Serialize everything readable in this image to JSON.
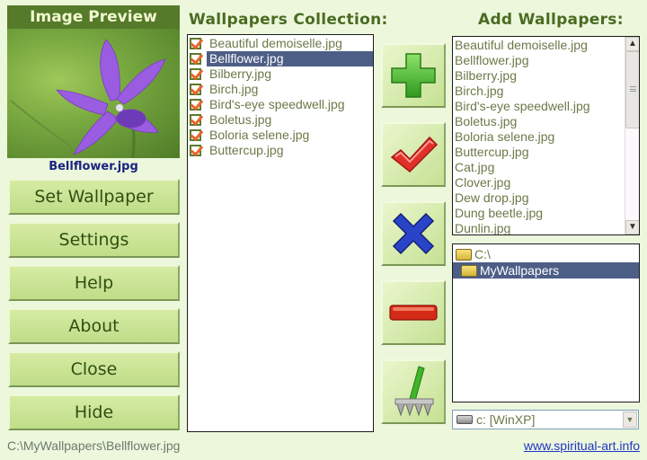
{
  "preview": {
    "title": "Image Preview",
    "caption": "Bellflower.jpg"
  },
  "left_buttons": [
    {
      "label": "Set Wallpaper"
    },
    {
      "label": "Settings"
    },
    {
      "label": "Help"
    },
    {
      "label": "About"
    },
    {
      "label": "Close"
    },
    {
      "label": "Hide"
    }
  ],
  "collection": {
    "title": "Wallpapers Collection:",
    "items": [
      {
        "label": "Beautiful demoiselle.jpg",
        "checked": true,
        "selected": false
      },
      {
        "label": "Bellflower.jpg",
        "checked": true,
        "selected": true
      },
      {
        "label": "Bilberry.jpg",
        "checked": true,
        "selected": false
      },
      {
        "label": "Birch.jpg",
        "checked": true,
        "selected": false
      },
      {
        "label": "Bird's-eye speedwell.jpg",
        "checked": true,
        "selected": false
      },
      {
        "label": "Boletus.jpg",
        "checked": true,
        "selected": false
      },
      {
        "label": "Boloria selene.jpg",
        "checked": true,
        "selected": false
      },
      {
        "label": "Buttercup.jpg",
        "checked": true,
        "selected": false
      }
    ]
  },
  "actions": [
    {
      "name": "add",
      "icon": "plus-icon"
    },
    {
      "name": "check",
      "icon": "checkmark-icon"
    },
    {
      "name": "uncheck",
      "icon": "x-icon"
    },
    {
      "name": "remove",
      "icon": "minus-icon"
    },
    {
      "name": "clean",
      "icon": "rake-icon"
    }
  ],
  "add": {
    "title": "Add Wallpapers:",
    "files": [
      "Beautiful demoiselle.jpg",
      "Bellflower.jpg",
      "Bilberry.jpg",
      "Birch.jpg",
      "Bird's-eye speedwell.jpg",
      "Boletus.jpg",
      "Boloria selene.jpg",
      "Buttercup.jpg",
      "Cat.jpg",
      "Clover.jpg",
      "Dew drop.jpg",
      "Dung beetle.jpg",
      "Dunlin.jpg"
    ],
    "folders": [
      {
        "label": "C:\\",
        "selected": false
      },
      {
        "label": "MyWallpapers",
        "selected": true
      }
    ],
    "drive": "c: [WinXP]"
  },
  "status": {
    "path": "C:\\MyWallpapers\\Bellflower.jpg",
    "link": "www.spiritual-art.info"
  }
}
